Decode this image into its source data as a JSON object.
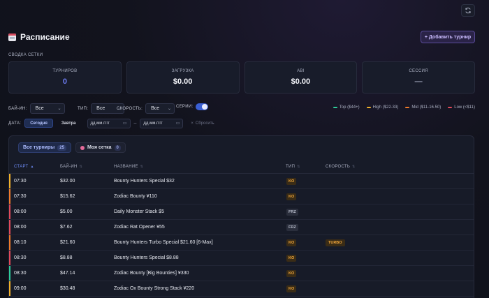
{
  "header": {
    "title": "Расписание",
    "add_button": "+ Добавить турнир"
  },
  "summary": {
    "label": "СВОДКА СЕТКИ",
    "cards": [
      {
        "label": "ТУРНИРОВ",
        "value": "0"
      },
      {
        "label": "ЗАГРУЗКА",
        "value": "$0.00"
      },
      {
        "label": "ABI",
        "value": "$0.00"
      },
      {
        "label": "СЕССИЯ",
        "value": "—"
      }
    ]
  },
  "filters": {
    "buyin_label": "БАЙ-ИН:",
    "buyin_value": "Все",
    "type_label": "ТИП:",
    "type_value": "Все",
    "speed_label": "СКОРОСТЬ:",
    "speed_value": "Все",
    "series_label": "СЕРИИ:",
    "series_on": true
  },
  "legend": [
    {
      "label": "Top ($44+)",
      "color": "#2ecc9a"
    },
    {
      "label": "High ($22-33)",
      "color": "#f2b12b"
    },
    {
      "label": "Mid ($11-16.50)",
      "color": "#f07a2a"
    },
    {
      "label": "Low (<$11)",
      "color": "#e24a5a"
    }
  ],
  "date": {
    "label": "ДАТА:",
    "today": "Сегодня",
    "tomorrow": "Завтра",
    "from_placeholder": "дд.мм.гггг",
    "to_placeholder": "дд.мм.гггг",
    "separator": "–",
    "reset": "Сбросить"
  },
  "tabs": [
    {
      "label": "Все турниры",
      "count": "25"
    },
    {
      "label": "Моя сетка",
      "count": "0"
    }
  ],
  "table": {
    "columns": [
      "СТАРТ",
      "БАЙ-ИН",
      "НАЗВАНИЕ",
      "ТИП",
      "СКОРОСТЬ"
    ],
    "sort_asc": "▲",
    "sort_idle": "⇅",
    "rows": [
      {
        "start": "07:30",
        "buyin": "$32.00",
        "name": "Bounty Hunters Special $32",
        "type": "KO",
        "speed": "",
        "tier_color": "#f2b12b"
      },
      {
        "start": "07:30",
        "buyin": "$15.62",
        "name": "Zodiac Bounty ¥110",
        "type": "KO",
        "speed": "",
        "tier_color": "#f07a2a"
      },
      {
        "start": "08:00",
        "buyin": "$5.00",
        "name": "Daily Monster Stack $5",
        "type": "FRZ",
        "speed": "",
        "tier_color": "#e24a5a"
      },
      {
        "start": "08:00",
        "buyin": "$7.62",
        "name": "Zodiac Rat Opener ¥55",
        "type": "FRZ",
        "speed": "",
        "tier_color": "#e24a5a"
      },
      {
        "start": "08:10",
        "buyin": "$21.60",
        "name": "Bounty Hunters Turbo Special $21.60 [6-Max]",
        "type": "KO",
        "speed": "TURBO",
        "tier_color": "#f07a2a"
      },
      {
        "start": "08:30",
        "buyin": "$8.88",
        "name": "Bounty Hunters Special $8.88",
        "type": "KO",
        "speed": "",
        "tier_color": "#e24a5a"
      },
      {
        "start": "08:30",
        "buyin": "$47.14",
        "name": "Zodiac Bounty [Big Bounties] ¥330",
        "type": "KO",
        "speed": "",
        "tier_color": "#2ecc9a"
      },
      {
        "start": "09:00",
        "buyin": "$30.48",
        "name": "Zodiac Ox Bounty Strong Stack ¥220",
        "type": "KO",
        "speed": "",
        "tier_color": "#f2b12b"
      }
    ]
  }
}
